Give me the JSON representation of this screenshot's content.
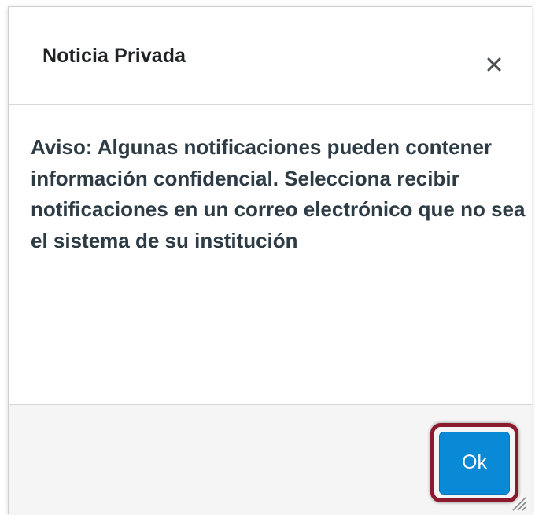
{
  "dialog": {
    "title": "Noticia Privada",
    "close_icon": "close-icon",
    "message": "Aviso: Algunas notificaciones pueden contener información confidencial. Selecciona recibir notificaciones en un correo electrónico que no sea el sistema de su institución",
    "ok_label": "Ok",
    "resize_icon": "resize-grip-icon"
  },
  "colors": {
    "ok_button": "#0a8ad6",
    "highlight_border": "#8b1b2c",
    "footer_bg": "#f5f5f5",
    "text": "#2d3b45"
  }
}
